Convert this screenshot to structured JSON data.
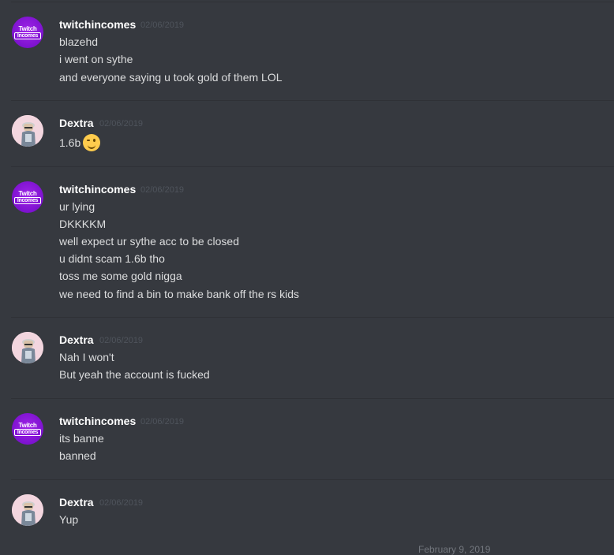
{
  "messages": [
    {
      "user": "twitchincomes",
      "time": "02/06/2019",
      "avatar_text": [
        "Twitch",
        "Incomes"
      ],
      "lines": [
        "blazehd",
        "i went on sythe",
        "and everyone saying u took gold of them LOL"
      ]
    },
    {
      "user": "Dextra",
      "time": "02/06/2019",
      "lines": [
        "1.6b"
      ],
      "emoji": "winking-face"
    },
    {
      "user": "twitchincomes",
      "time": "02/06/2019",
      "avatar_text": [
        "Twitch",
        "Incomes"
      ],
      "lines": [
        "ur lying",
        "DKKKKM",
        "well expect ur sythe acc to be closed",
        "u didnt scam 1.6b tho",
        "toss me some gold nigga",
        "we need to find a bin to make bank off the rs kids"
      ]
    },
    {
      "user": "Dextra",
      "time": "02/06/2019",
      "lines": [
        "Nah I won't",
        "But yeah the account is fucked"
      ]
    },
    {
      "user": "twitchincomes",
      "time": "02/06/2019",
      "avatar_text": [
        "Twitch",
        "Incomes"
      ],
      "lines": [
        "its banne",
        "banned"
      ]
    },
    {
      "user": "Dextra",
      "time": "02/06/2019",
      "lines": [
        "Yup"
      ]
    }
  ],
  "date_separator": "February 9, 2019",
  "colors": {
    "background": "#36393f",
    "username": "#ffffff",
    "message_text": "#dcddde",
    "timestamp": "#4f545c"
  }
}
